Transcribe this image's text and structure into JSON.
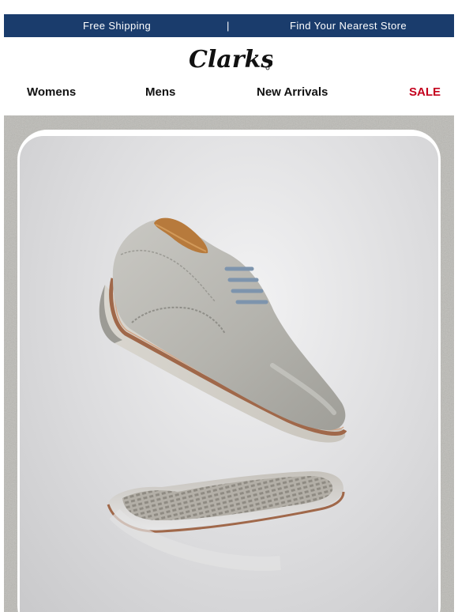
{
  "topbar": {
    "free_shipping": "Free Shipping",
    "divider": "|",
    "find_store": "Find Your Nearest Store"
  },
  "brand": {
    "name": "Clarks"
  },
  "nav": {
    "items": [
      "Womens",
      "Mens",
      "New Arrivals"
    ],
    "sale": "SALE"
  },
  "hero": {
    "product_icon": "tan-derby-shoe-image"
  },
  "colors": {
    "topbar": "#1a3c6c",
    "sale": "#c4001d"
  }
}
